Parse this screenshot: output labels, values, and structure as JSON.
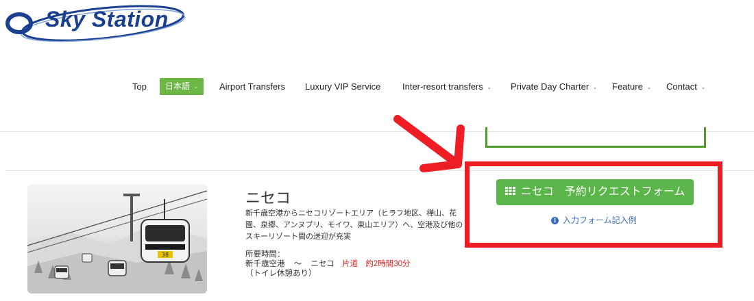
{
  "logo": {
    "text": "Sky Station"
  },
  "nav": {
    "items": [
      {
        "label": "Top"
      },
      {
        "label": "日本語",
        "caret": "⌄"
      },
      {
        "label": "Airport Transfers"
      },
      {
        "label": "Luxury VIP Service"
      },
      {
        "label": "Inter-resort transfers",
        "caret": "⌄"
      },
      {
        "label": "Private Day Charter",
        "caret": "⌄"
      },
      {
        "label": "Feature",
        "caret": "⌄"
      },
      {
        "label": "Contact",
        "caret": "⌄"
      }
    ]
  },
  "resort": {
    "title": "ニセコ",
    "description": "新千歳空港からニセコリゾートエリア（ヒラフ地区、樺山、花園、泉郷、アンヌプリ、モイワ、東山エリア）へ、空港及び他のスキーリゾート間の送迎が充実",
    "time_label": "所要時間：",
    "route_from": "新千歳空港",
    "route_sep": "～",
    "route_to": "ニセコ",
    "oneway": "片道",
    "duration": "約2時間30分",
    "note": "（トイレ休憩あり）",
    "gondola_number": "38"
  },
  "booking": {
    "button_label": "ニセコ　予約リクエストフォーム",
    "example_link": "入力フォーム記入例"
  },
  "colors": {
    "accent_green": "#5cb54a",
    "nav_green": "#6db545",
    "annotation_red": "#ee1c25",
    "link_blue": "#3a6fb8",
    "brand_blue": "#1a3f8f"
  }
}
